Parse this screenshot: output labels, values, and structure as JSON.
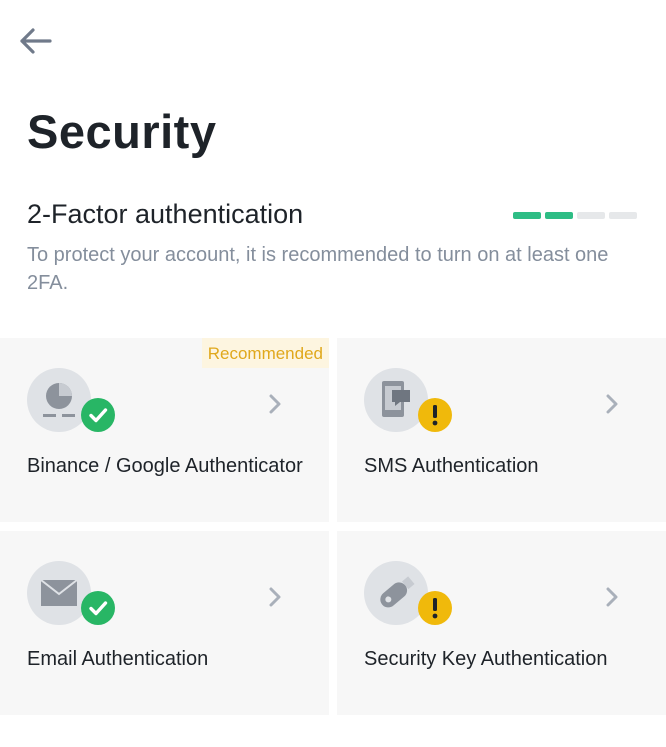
{
  "header": {
    "back_icon": "arrow-left-icon"
  },
  "page": {
    "title": "Security"
  },
  "two_factor": {
    "heading": "2-Factor authentication",
    "description": "To protect your account, it is recommended to turn on at least one 2FA.",
    "progress": {
      "enabled": 2,
      "total": 4,
      "active_color": "#2ebd85",
      "inactive_color": "#e6e8ea"
    }
  },
  "methods": [
    {
      "label": "Binance / Google Authenticator",
      "badge": "Recommended",
      "status": "enabled",
      "icon": "authenticator-icon"
    },
    {
      "label": "SMS Authentication",
      "badge": "",
      "status": "warning",
      "icon": "sms-phone-icon"
    },
    {
      "label": "Email Authentication",
      "badge": "",
      "status": "enabled",
      "icon": "envelope-icon"
    },
    {
      "label": "Security Key Authentication",
      "badge": "",
      "status": "warning",
      "icon": "usb-key-icon"
    }
  ],
  "colors": {
    "ok": "#28b665",
    "warn": "#f0b90b",
    "badge_text": "#e0a81c",
    "badge_bg": "#fdf5e0"
  }
}
